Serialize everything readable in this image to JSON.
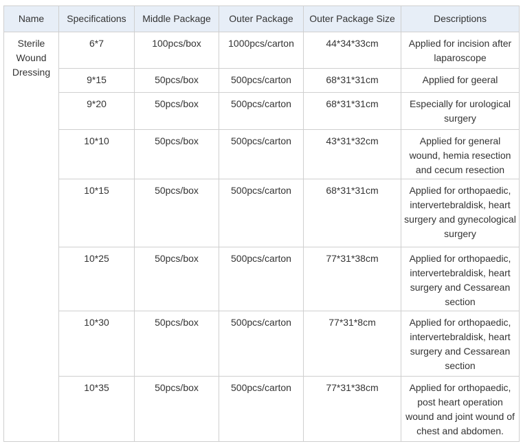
{
  "table": {
    "headers": [
      "Name",
      "Specifications",
      "Middle Package",
      "Outer Package",
      "Outer Package Size",
      "Descriptions"
    ],
    "product_name": "Sterile Wound Dressing",
    "rows": [
      {
        "spec": "6*7",
        "middle": "100pcs/box",
        "outer": "1000pcs/carton",
        "size": "44*34*33cm",
        "desc": "Applied for incision after laparoscope"
      },
      {
        "spec": "9*15",
        "middle": "50pcs/box",
        "outer": "500pcs/carton",
        "size": "68*31*31cm",
        "desc": "Applied for geeral"
      },
      {
        "spec": "9*20",
        "middle": "50pcs/box",
        "outer": "500pcs/carton",
        "size": "68*31*31cm",
        "desc": "Especially for urological surgery"
      },
      {
        "spec": "10*10",
        "middle": "50pcs/box",
        "outer": "500pcs/carton",
        "size": "43*31*32cm",
        "desc": "Applied for general wound, hemia resection and cecum resection"
      },
      {
        "spec": "10*15",
        "middle": "50pcs/box",
        "outer": "500pcs/carton",
        "size": "68*31*31cm",
        "desc": "Applied for orthopaedic, intervertebraldisk, heart surgery and gynecological surgery"
      },
      {
        "spec": "10*25",
        "middle": "50pcs/box",
        "outer": "500pcs/carton",
        "size": "77*31*38cm",
        "desc": "Applied for orthopaedic, intervertebraldisk, heart surgery and Cessarean section"
      },
      {
        "spec": "10*30",
        "middle": "50pcs/box",
        "outer": "500pcs/carton",
        "size": "77*31*8cm",
        "desc": "Applied for orthopaedic, intervertebraldisk, heart surgery and Cessarean section"
      },
      {
        "spec": "10*35",
        "middle": "50pcs/box",
        "outer": "500pcs/carton",
        "size": "77*31*38cm",
        "desc": "Applied for orthopaedic, post heart operation wound and joint wound of chest and abdomen."
      }
    ]
  }
}
